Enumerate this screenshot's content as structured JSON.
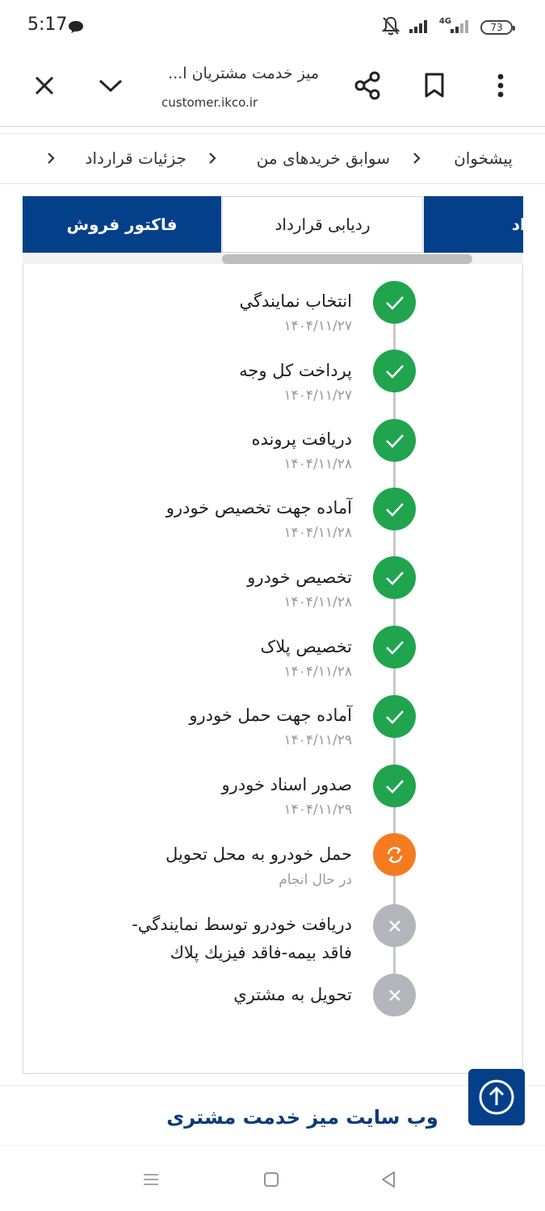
{
  "status_bar": {
    "time": "5:17",
    "network": "4G",
    "battery": "73"
  },
  "browser": {
    "page_title": "میز خدمت مشتریان ا...",
    "url": "customer.ikco.ir",
    "icons": [
      "close-icon",
      "chevron-down-icon",
      "share-icon",
      "bookmark-icon",
      "more-icon"
    ]
  },
  "breadcrumb": {
    "items": [
      "پیشخوان",
      "سوابق خریدهای من",
      "جزئیات قرارداد"
    ]
  },
  "tabs": [
    {
      "label": "قرارداد"
    },
    {
      "label": "ردیابی قرارداد"
    },
    {
      "label": "فاکتور فروش"
    }
  ],
  "tracking": {
    "steps": [
      {
        "title": "انتخاب نمايندگي",
        "date": "۱۴۰۴/۱۱/۲۷",
        "status": "done"
      },
      {
        "title": "پرداخت کل وجه",
        "date": "۱۴۰۴/۱۱/۲۷",
        "status": "done"
      },
      {
        "title": "دریافت پرونده",
        "date": "۱۴۰۴/۱۱/۲۸",
        "status": "done"
      },
      {
        "title": "آماده جهت تخصيص خودرو",
        "date": "۱۴۰۴/۱۱/۲۸",
        "status": "done"
      },
      {
        "title": "تخصيص خودرو",
        "date": "۱۴۰۴/۱۱/۲۸",
        "status": "done"
      },
      {
        "title": "تخصيص پلاک",
        "date": "۱۴۰۴/۱۱/۲۸",
        "status": "done"
      },
      {
        "title": "آماده جهت حمل خودرو",
        "date": "۱۴۰۴/۱۱/۲۹",
        "status": "done"
      },
      {
        "title": "صدور اسناد خودرو",
        "date": "۱۴۰۴/۱۱/۲۹",
        "status": "done"
      },
      {
        "title": "حمل خودرو به محل تحويل",
        "date": "در حال انجام",
        "status": "in-progress"
      },
      {
        "title": "دريافت خودرو توسط نمايندگي-",
        "title_line2": "فاقد بيمه-فاقد فيزيك پلاك",
        "date": "",
        "status": "pending"
      },
      {
        "title": "تحويل به مشتري",
        "date": "",
        "status": "pending"
      }
    ]
  },
  "footer": {
    "title": "وب سایت میز خدمت مشتری"
  },
  "colors": {
    "primary": "#04408a",
    "done": "#20a44e",
    "in_progress": "#f47b20",
    "pending": "#b3b6bb",
    "footer_title": "#0c3b7a"
  }
}
